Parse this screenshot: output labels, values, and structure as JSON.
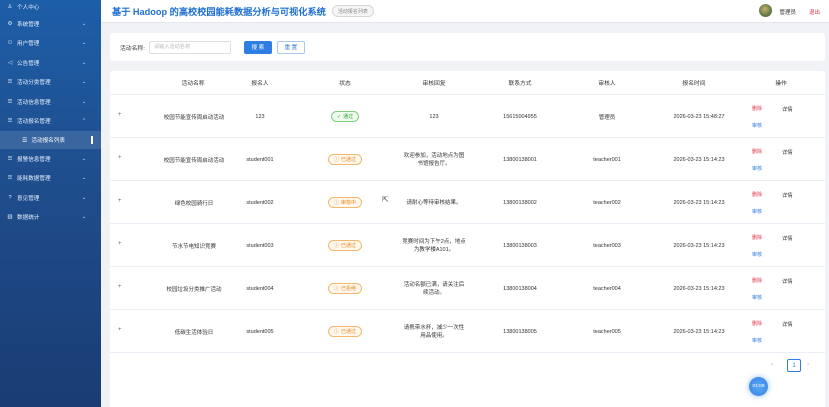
{
  "sidebar": {
    "items": [
      {
        "icon": "person",
        "label": "个人中心",
        "chevron": ""
      },
      {
        "icon": "gear",
        "label": "系统管理",
        "chevron": "⌄"
      },
      {
        "icon": "users",
        "label": "用户管理",
        "chevron": "⌄"
      },
      {
        "icon": "bell",
        "label": "公告管理",
        "chevron": "⌄"
      },
      {
        "icon": "list",
        "label": "活动分类管理",
        "chevron": "⌄"
      },
      {
        "icon": "list",
        "label": "活动信息管理",
        "chevron": "⌄"
      },
      {
        "icon": "list",
        "label": "活动报名管理",
        "chevron": "⌃"
      }
    ],
    "sub_item": {
      "label": "活动报名列表"
    },
    "items_after": [
      {
        "icon": "list",
        "label": "报警信息管理",
        "chevron": "⌄"
      },
      {
        "icon": "list",
        "label": "能耗数据管理",
        "chevron": "⌄"
      },
      {
        "icon": "question",
        "label": "意见管理",
        "chevron": "⌄"
      },
      {
        "icon": "chart",
        "label": "数据统计",
        "chevron": "⌄"
      }
    ]
  },
  "header": {
    "title": "基于 Hadoop 的高校校园能耗数据分析与可视化系统",
    "tag": "活动报名列表",
    "user": "管理员",
    "logout": "退出"
  },
  "search": {
    "label": "活动名称:",
    "placeholder": "请输入活动名称",
    "search_btn": "搜 索",
    "reset_btn": "重 置"
  },
  "table": {
    "headers": [
      "活动名称",
      "报名人",
      "状态",
      "审核回复",
      "联系方式",
      "审核人",
      "报名时间",
      "操作"
    ],
    "rows": [
      {
        "expand": "+",
        "name": "校园节能宣传周启动活动",
        "applicant": "123",
        "status": "通过",
        "status_icon": "✓",
        "reply": [
          "123"
        ],
        "contact": "15615004955",
        "reviewer": "管理员",
        "time": "2026-03-23 15:48:27",
        "del": "删除",
        "detail": "详情",
        "review": "审核"
      },
      {
        "expand": "+",
        "name": "校园节能宣传周启动活动",
        "applicant": "student001",
        "status": "已通过",
        "status_icon": "ⓘ",
        "reply": [
          "欢迎参加，活动地点为图",
          "书馆报告厅。"
        ],
        "contact": "13800138001",
        "reviewer": "teacher001",
        "time": "2026-03-23 15:14:23",
        "del": "删除",
        "detail": "详情",
        "review": "审核"
      },
      {
        "expand": "+",
        "name": "绿色校园骑行日",
        "applicant": "student002",
        "status": "审核中",
        "status_icon": "ⓘ",
        "reply": [
          "请耐心等待审核结果。"
        ],
        "contact": "13800138002",
        "reviewer": "teacher002",
        "time": "2026-03-23 15:14:23",
        "del": "删除",
        "detail": "详情",
        "review": "审核"
      },
      {
        "expand": "+",
        "name": "节水节电知识竞赛",
        "applicant": "student003",
        "status": "已通过",
        "status_icon": "ⓘ",
        "reply": [
          "竞赛时间为下午2点，地点",
          "为教学楼A101。"
        ],
        "contact": "13800138003",
        "reviewer": "teacher003",
        "time": "2026-03-23 15:14:23",
        "del": "删除",
        "detail": "详情",
        "review": "审核"
      },
      {
        "expand": "+",
        "name": "校园垃圾分类推广活动",
        "applicant": "student004",
        "status": "已拒绝",
        "status_icon": "ⓘ",
        "reply": [
          "活动名额已满，请关注后",
          "续活动。"
        ],
        "contact": "13800138004",
        "reviewer": "teacher004",
        "time": "2026-03-23 15:14:23",
        "del": "删除",
        "detail": "详情",
        "review": "审核"
      },
      {
        "expand": "+",
        "name": "低碳生活体验日",
        "applicant": "student005",
        "status": "已通过",
        "status_icon": "ⓘ",
        "reply": [
          "请携带水杯，减少一次性",
          "用品使用。"
        ],
        "contact": "13800138005",
        "reviewer": "teacher005",
        "time": "2026-03-23 15:14:23",
        "del": "删除",
        "detail": "详情",
        "review": "审核"
      }
    ]
  },
  "pagination": {
    "prev": "‹",
    "current": "1",
    "next": "›"
  },
  "float_button": {
    "label": "01:09"
  },
  "colors": {
    "primary": "#2d7de3",
    "danger": "#e0344a",
    "sidebar": "#1f4f8f"
  }
}
